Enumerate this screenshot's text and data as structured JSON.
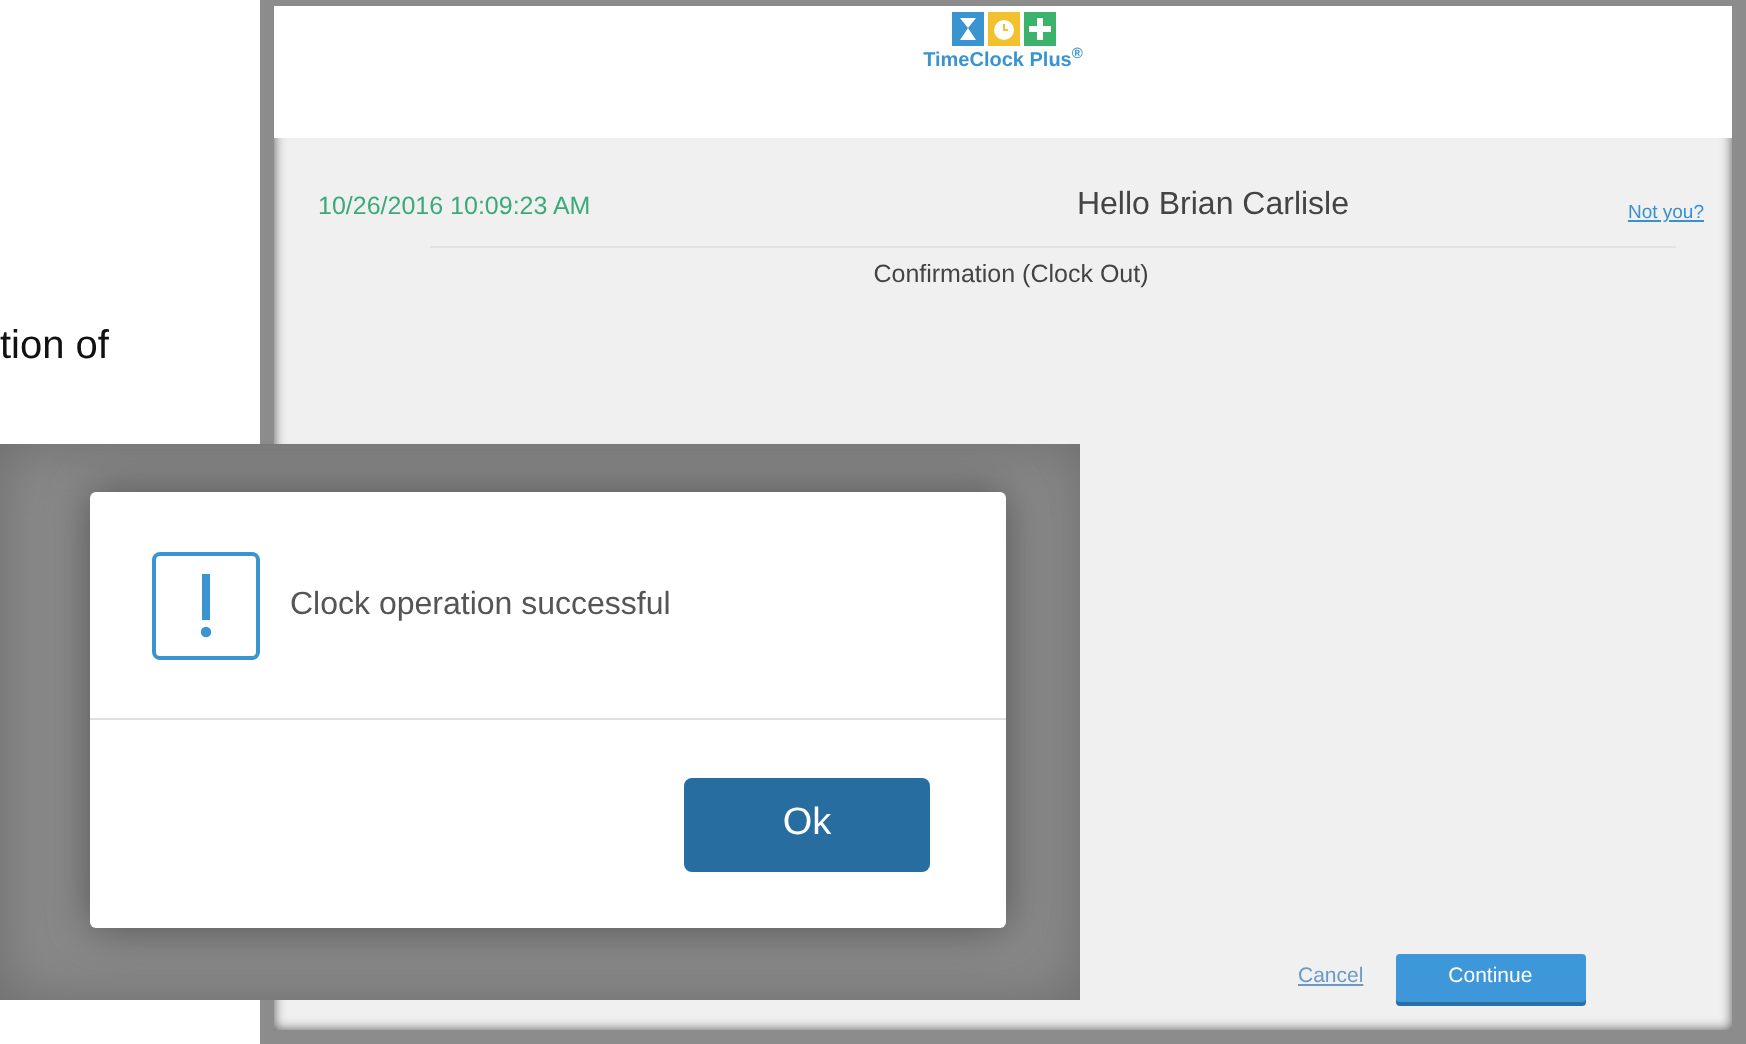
{
  "document_text": "tion of",
  "app": {
    "logo": {
      "text": "TimeClock Plus$^{®}$"
    },
    "timestamp": "10/26/2016 10:09:23 AM",
    "greeting": "Hello Brian Carlisle",
    "not_you_link": "Not you?",
    "subtitle": "Confirmation (Clock Out)",
    "buttons": [
      {
        "label": "Cancel",
        "kind": "link"
      },
      {
        "label": "Continue",
        "kind": "primary"
      }
    ]
  },
  "dialog": {
    "message": "Clock operation successful",
    "button": "Ok"
  }
}
